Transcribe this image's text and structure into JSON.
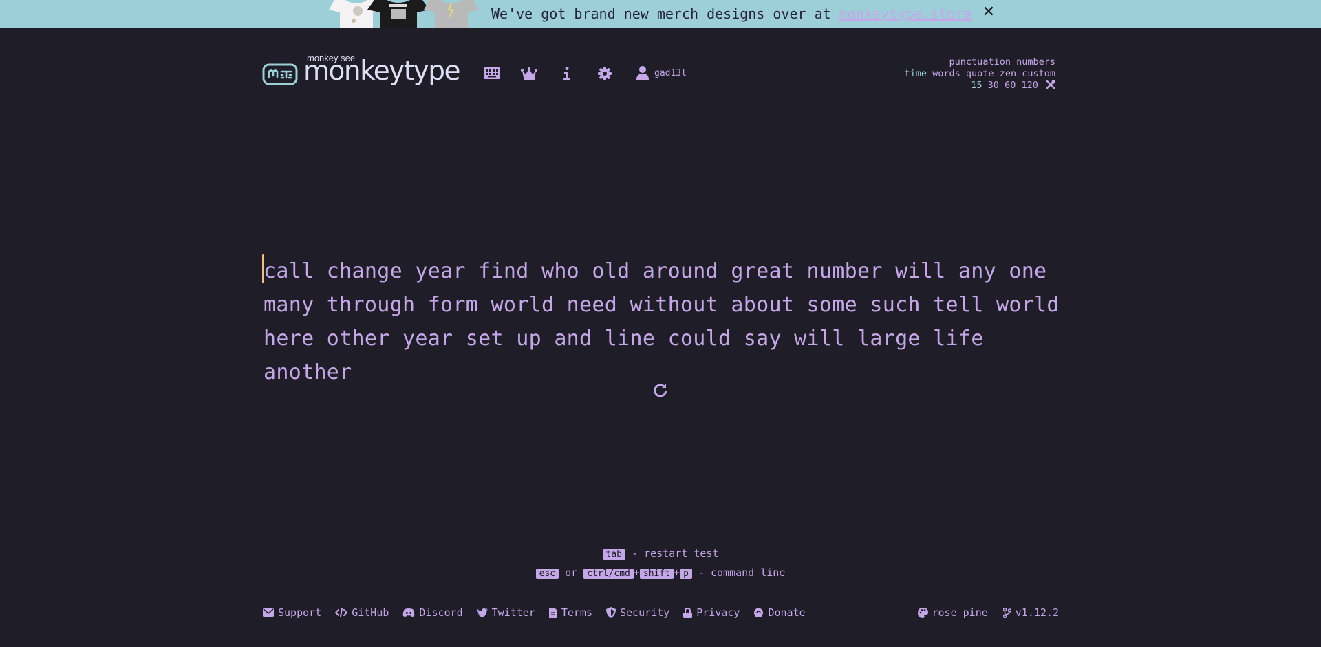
{
  "banner": {
    "text": "We've got brand new merch designs over at ",
    "link": "monkeytype.store",
    "close_icon": "close-icon",
    "bg": "#9ccfd8"
  },
  "logo": {
    "tagline": "monkey see",
    "name": "monkeytype"
  },
  "nav": {
    "icons": [
      "keyboard-icon",
      "crown-icon",
      "info-icon",
      "gear-icon",
      "user-icon"
    ],
    "username": "gad13l"
  },
  "config": {
    "row1": [
      "punctuation",
      "numbers"
    ],
    "row2": [
      "time",
      "words",
      "quote",
      "zen",
      "custom"
    ],
    "row3": [
      "15",
      "30",
      "60",
      "120"
    ],
    "active_mode": "time",
    "active_time": "15"
  },
  "words": {
    "line1": "call change year find who old around great number will any one",
    "line2": "many through form world need without about some such tell world",
    "line3": "here other year set up and line could say will large life another"
  },
  "hints": {
    "restart_key": "tab",
    "restart_text": " - restart test",
    "esc_key": "esc",
    "or_text": " or ",
    "ctrl_key": "ctrl/cmd",
    "plus": "+",
    "shift_key": "shift",
    "p_key": "p",
    "command_text": " - command line"
  },
  "footer": {
    "links": [
      "Support",
      "GitHub",
      "Discord",
      "Twitter",
      "Terms",
      "Security",
      "Privacy",
      "Donate"
    ],
    "theme": "rose pine",
    "version": "v1.12.2"
  },
  "colors": {
    "bg": "#1f1d27",
    "text": "#c4a7e7",
    "caret": "#f6c177",
    "accent": "#9ccfd8"
  }
}
